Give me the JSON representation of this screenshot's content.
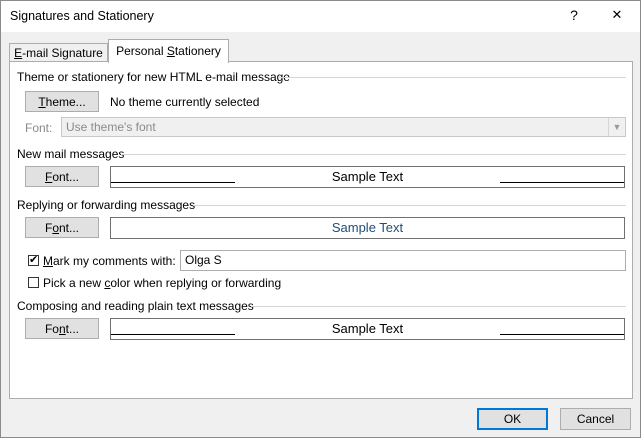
{
  "window": {
    "title": "Signatures and Stationery",
    "help_label": "?",
    "close_label": "✕"
  },
  "tabs": [
    {
      "label_pre": "",
      "label_ul": "E",
      "label_post": "-mail Signature"
    },
    {
      "label_pre": "Personal ",
      "label_ul": "S",
      "label_post": "tationery"
    }
  ],
  "theme_section": {
    "heading": "Theme or stationery for new HTML e-mail message",
    "theme_button": {
      "pre": "",
      "ul": "T",
      "post": "heme..."
    },
    "theme_status": "No theme currently selected",
    "font_label": "Font:",
    "font_select_value": "Use theme's font"
  },
  "new_mail": {
    "heading": "New mail messages",
    "font_button": {
      "pre": "",
      "ul": "F",
      "post": "ont..."
    },
    "sample_text": "Sample Text",
    "sample_color": "#000000"
  },
  "reply_forward": {
    "heading": "Replying or forwarding messages",
    "font_button": {
      "pre": "F",
      "ul": "o",
      "post": "nt..."
    },
    "sample_text": "Sample Text",
    "sample_color": "#1f4e79",
    "mark_comments": {
      "pre": "",
      "ul": "M",
      "post": "ark my comments with:",
      "checked": "✔"
    },
    "mark_value": "Olga S",
    "pick_color": {
      "pre": "Pick a new ",
      "ul": "c",
      "post": "olor when replying or forwarding"
    }
  },
  "plain_text": {
    "heading": "Composing and reading plain text messages",
    "font_button": {
      "pre": "Fo",
      "ul": "n",
      "post": "t..."
    },
    "sample_text": "Sample Text",
    "sample_color": "#000000"
  },
  "footer": {
    "ok_label": "OK",
    "cancel_label": "Cancel"
  }
}
